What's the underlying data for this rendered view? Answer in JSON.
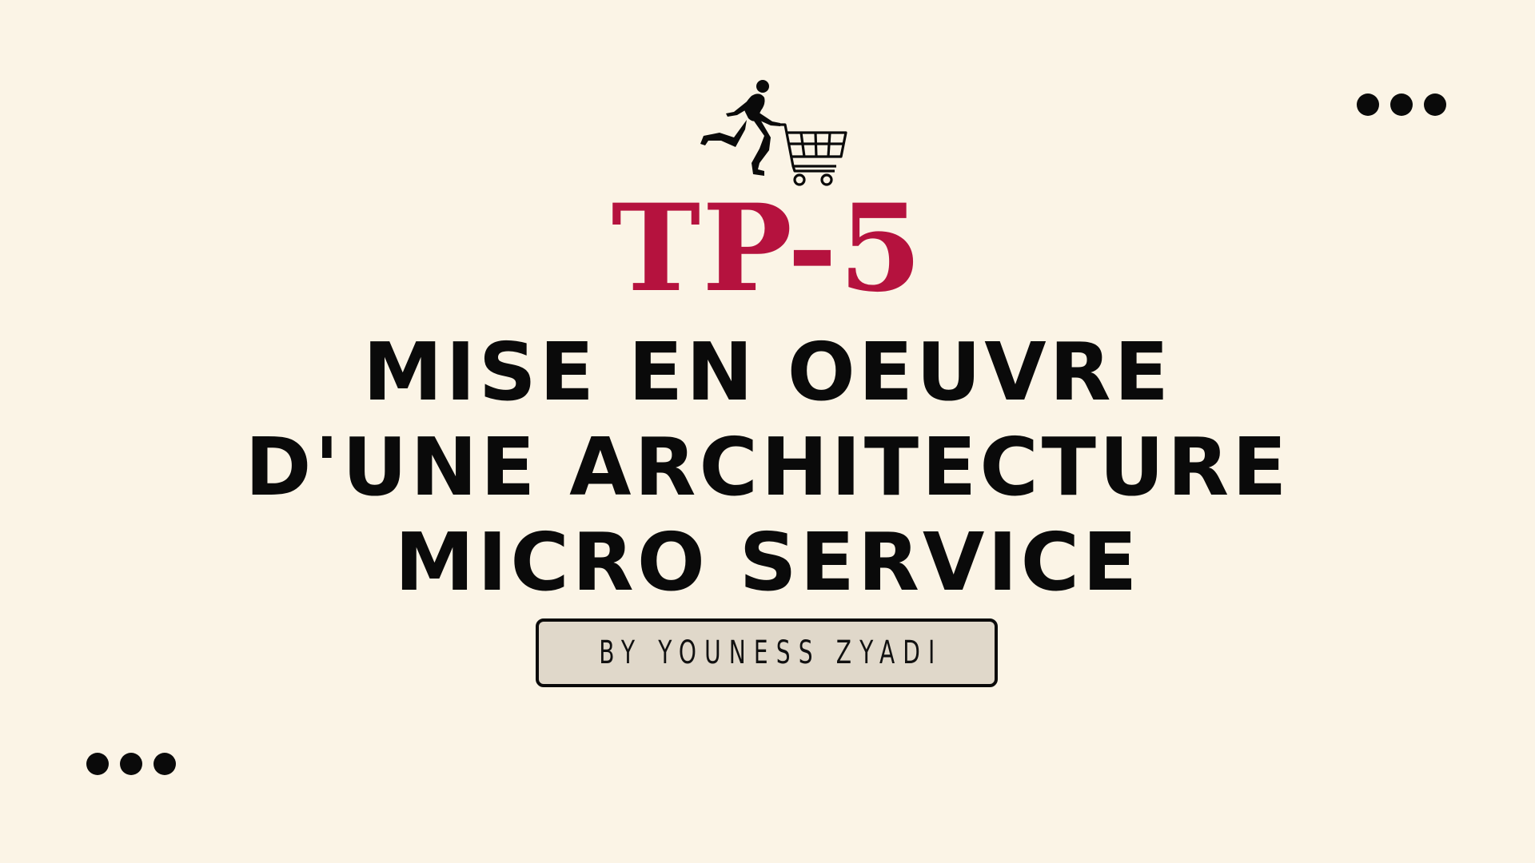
{
  "slide": {
    "tp_label": "TP-5",
    "title_lines": [
      "MISE EN OEUVRE",
      "D'UNE ARCHITECTURE",
      "MICRO SERVICE"
    ],
    "author": "BY YOUNESS ZYADI"
  },
  "icons": {
    "illustration": "person-pushing-shopping-cart-icon",
    "decor": "three-dots-icon"
  },
  "colors": {
    "background": "#FBF4E6",
    "accent": "#B5123E",
    "text": "#0A0A0A",
    "author_box": "#E0D8CA"
  }
}
